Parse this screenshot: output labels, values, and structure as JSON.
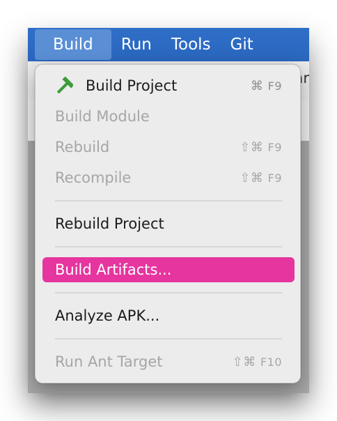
{
  "menubar": {
    "items": [
      {
        "label": "Build",
        "active": true
      },
      {
        "label": "Run",
        "active": false
      },
      {
        "label": "Tools",
        "active": false
      },
      {
        "label": "Git",
        "active": false
      }
    ]
  },
  "background": {
    "peek_text": "ar"
  },
  "build_menu": {
    "items": [
      {
        "label": "Build Project",
        "shortcut_mod": "⌘",
        "shortcut_key": "F9",
        "enabled": true,
        "icon": "hammer-icon"
      },
      {
        "label": "Build Module",
        "shortcut_mod": "",
        "shortcut_key": "",
        "enabled": false
      },
      {
        "label": "Rebuild",
        "shortcut_mod": "⇧⌘",
        "shortcut_key": "F9",
        "enabled": false
      },
      {
        "label": "Recompile",
        "shortcut_mod": "⇧⌘",
        "shortcut_key": "F9",
        "enabled": false
      },
      {
        "label": "Rebuild Project",
        "shortcut_mod": "",
        "shortcut_key": "",
        "enabled": true
      },
      {
        "label": "Build Artifacts...",
        "shortcut_mod": "",
        "shortcut_key": "",
        "enabled": true,
        "highlighted": true
      },
      {
        "label": "Analyze APK...",
        "shortcut_mod": "",
        "shortcut_key": "",
        "enabled": true
      },
      {
        "label": "Run Ant Target",
        "shortcut_mod": "⇧⌘",
        "shortcut_key": "F10",
        "enabled": false
      }
    ]
  },
  "colors": {
    "menubar_bg": "#2d6bc5",
    "menubar_active": "#5a8fd6",
    "highlight": "#e6359f",
    "hammer_handle": "#3f9b3a",
    "hammer_head": "#3f9b3a"
  }
}
